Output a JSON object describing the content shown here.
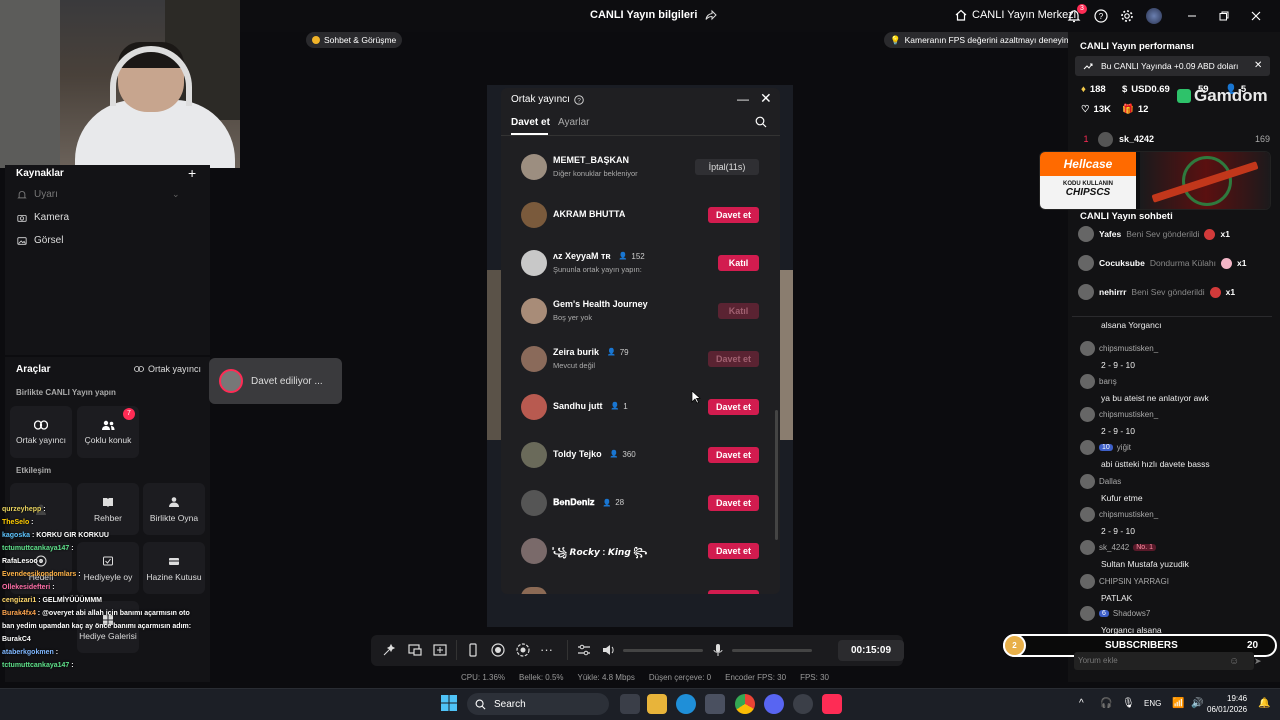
{
  "topbar": {
    "title": "CANLI Yayın bilgileri",
    "center_link": "CANLI Yayın Merkezi",
    "notif_count": "3"
  },
  "webcam_watermark": "",
  "left": {
    "sources_title": "Kaynaklar",
    "sources": [
      "Uyarı",
      "Kamera",
      "Görsel"
    ],
    "tools_title": "Araçlar",
    "tools_link": "Ortak yayıncı",
    "together_section": "Birlikte CANLI Yayın yapın",
    "tool_items": [
      {
        "label": "Ortak yayıncı"
      },
      {
        "label": "Çoklu konuk",
        "badge": "7"
      }
    ],
    "interaction_section": "Etkileşim",
    "interaction_items": [
      "Rehber",
      "Birlikte Oyna",
      "Hedefi",
      "Hediyeyle oy",
      "Hazine Kutusu",
      "Hediye Galerisi"
    ],
    "invite_toast": "Davet ediliyor ..."
  },
  "overlay_chat": [
    {
      "user": "qurzeyhepp",
      "text": "",
      "color": "#e7d25e"
    },
    {
      "user": "TheSelo",
      "text": "",
      "color": "#ffcc00"
    },
    {
      "user": "kagoska",
      "text": "KORKU GIR KORKUU",
      "color": "#5ec5ff"
    },
    {
      "user": "tctumuttcankaya147",
      "text": "",
      "color": "#5ee08a"
    },
    {
      "user": "RafaLesoo",
      "text": "",
      "color": "#ffffff"
    },
    {
      "user": "Evendeesikondomlars",
      "text": "",
      "color": "#ffb347"
    },
    {
      "user": "Ollekesidefteri",
      "text": "",
      "color": "#ff6fa8"
    },
    {
      "user": "cengizari1",
      "text": "GELMİYÜÜÜMMM",
      "color": "#ffd86b"
    },
    {
      "user": "Burak4fx4",
      "text": "@overyet abi allah için banımı açarmısın oto",
      "color": "#ffa54f"
    },
    {
      "user": "",
      "text": "ban yedim upamdan kaç ay önce banımı açarmısın adım:",
      "color": "#ffffff"
    },
    {
      "user": "",
      "text": "BurakC4",
      "color": "#ffffff"
    },
    {
      "user": "ataberkgokmen",
      "text": "",
      "color": "#7fb7ff"
    },
    {
      "user": "tctumuttcankaya147",
      "text": "",
      "color": "#5ee08a"
    }
  ],
  "top_pills": {
    "chat_pill": "Sohbet & Görüşme",
    "tip": "Kameranın FPS değerini azaltmayı deneyin"
  },
  "modal": {
    "title": "Ortak yayıncı",
    "tab_invite": "Davet et",
    "tab_settings": "Ayarlar",
    "rows": [
      {
        "name": "MEMET_BAŞKAN",
        "count": "",
        "sub": "Diğer konuklar bekleniyor",
        "btn": "İptal(11s)",
        "style": "gray"
      },
      {
        "name": "AKRAM BHUTTA",
        "count": "",
        "sub": "",
        "btn": "Davet et",
        "style": "red"
      },
      {
        "name": "ʌz XeyyaM ᴛʀ",
        "count": "152",
        "sub": "Şununla ortak yayın yapın:",
        "btn": "Katıl",
        "style": "red"
      },
      {
        "name": "Gem's Health Journey",
        "count": "",
        "sub": "Boş yer yok",
        "btn": "Katıl",
        "style": "dim"
      },
      {
        "name": "Zeira burik",
        "count": "79",
        "sub": "Mevcut değil",
        "btn": "Davet et",
        "style": "dim"
      },
      {
        "name": "Sandhu jutt",
        "count": "1",
        "sub": "",
        "btn": "Davet et",
        "style": "red"
      },
      {
        "name": "Toldy Tejko",
        "count": "360",
        "sub": "",
        "btn": "Davet et",
        "style": "red"
      },
      {
        "name": "𝐁𝐞𝐧𝐃𝐞𝐧𝐢𝐳",
        "count": "28",
        "sub": "",
        "btn": "Davet et",
        "style": "red"
      },
      {
        "name": "ᷤ꧁ 𝙍𝙤𝙘𝙠𝙮 : 𝙆𝙞𝙣𝙜 ꧂",
        "count": "",
        "sub": "",
        "btn": "Davet et",
        "style": "red"
      }
    ]
  },
  "toolbar": {
    "timer": "00:15:09"
  },
  "stats": {
    "cpu": "CPU: 1.36%",
    "mem": "Bellek: 0.5%",
    "upload": "Yükle: 4.8 Mbps",
    "dropped": "Düşen çerçeve: 0",
    "encoder": "Encoder FPS: 30",
    "fps": "FPS: 30"
  },
  "right": {
    "perf_title": "CANLI Yayın performansı",
    "earn_banner": "Bu CANLI Yayında +0.09 ABD doları",
    "diamonds": "188",
    "usd": "USD0.69",
    "viewers_a": "59",
    "viewers_b": "5",
    "likes": "13K",
    "gifts": "12",
    "brand": "Gamdom",
    "rank_num": "1",
    "rank_user": "sk_4242",
    "rank_score": "169",
    "ad_brand": "Hellcase",
    "ad_line1": "KODU KULLANIN",
    "ad_code": "CHIPSCS",
    "chat_title": "CANLI Yayın sohbeti",
    "gifts_list": [
      {
        "user": "Yafes",
        "text": "Beni Sev gönderildi",
        "mult": "x1",
        "color": "#d23a3a"
      },
      {
        "user": "Cocuksube",
        "text": "Dondurma Külahı",
        "mult": "x1",
        "color": "#f3b6c7"
      },
      {
        "user": "nehirrr",
        "text": "Beni Sev gönderildi",
        "mult": "x1",
        "color": "#d23a3a"
      }
    ],
    "messages": [
      {
        "user": "",
        "text": "alsana Yorgancı"
      },
      {
        "user": "chipsmustisken_",
        "text": "2 - 9 - 10"
      },
      {
        "user": "barış",
        "text": "ya bu ateist ne anlatıyor awk"
      },
      {
        "user": "chipsmustisken_",
        "text": "2 - 9 - 10"
      },
      {
        "user": "yiğit",
        "text": "abi üstteki hızlı davete basss",
        "lvl": "10"
      },
      {
        "user": "Dallas",
        "text": "Kufur etme"
      },
      {
        "user": "chipsmustisken_",
        "text": "2 - 9 - 10"
      },
      {
        "user": "sk_4242",
        "text": "Sultan Mustafa yuzudik",
        "badge": "No. 1"
      },
      {
        "user": "CHIPSIN YARRAGI",
        "text": "PATLAK"
      },
      {
        "user": "Shadows7",
        "text": "Yorgancı alsana",
        "lvl": "6"
      }
    ],
    "subs_label": "SUBSCRIBERS",
    "subs_count": "20",
    "subs_circle": "2",
    "comment_placeholder": "Yorum ekle"
  },
  "taskbar": {
    "search": "Search",
    "lang": "ENG",
    "time": "19:46",
    "date": "06/01/2026"
  }
}
